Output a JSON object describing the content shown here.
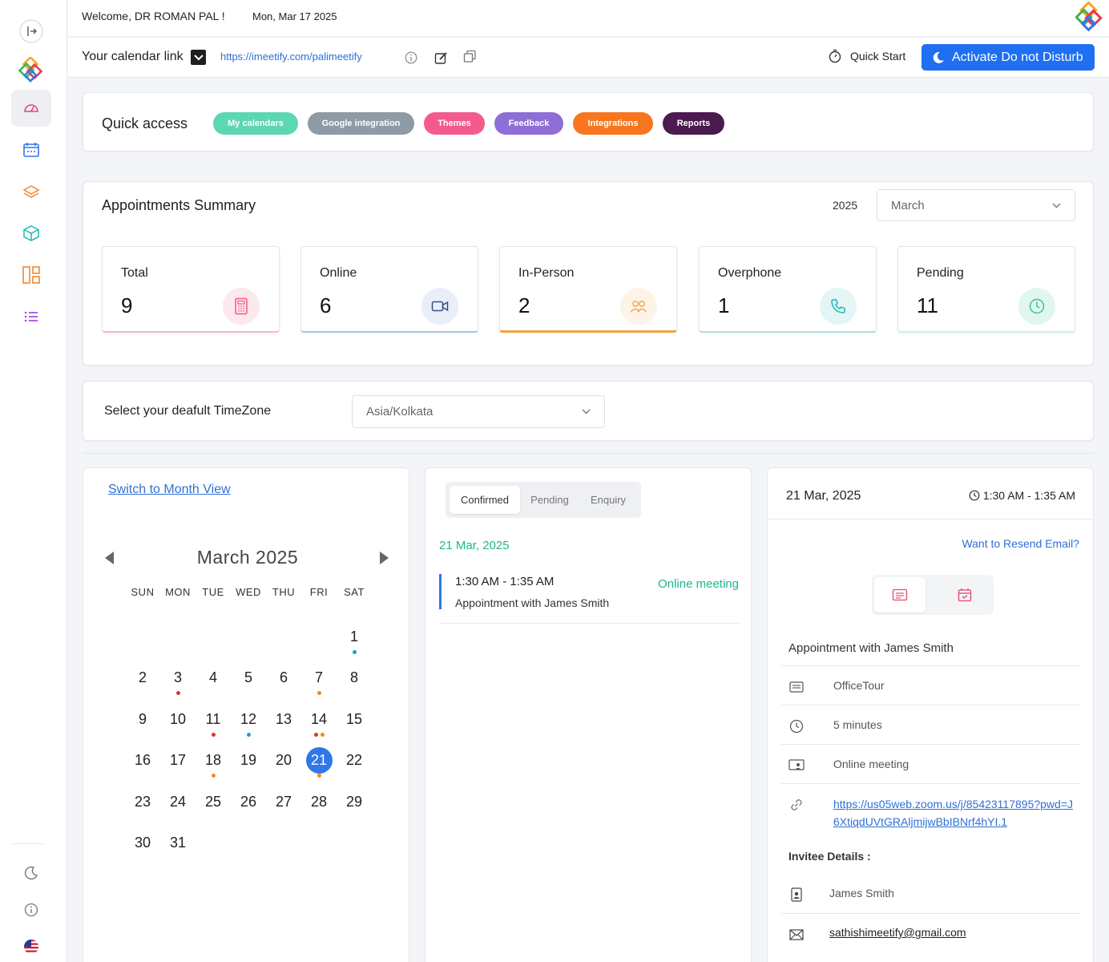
{
  "header": {
    "welcome": "Welcome, DR ROMAN PAL !",
    "date": "Mon, Mar 17 2025",
    "calendar_link_label": "Your calendar link",
    "calendar_url": "https://imeetify.com/palimeetify",
    "quick_start": "Quick Start",
    "dnd_button": "Activate Do not Disturb"
  },
  "quick_access": {
    "title": "Quick access",
    "pills": [
      {
        "label": "My calendars",
        "color": "#5dd6b2"
      },
      {
        "label": "Google integration",
        "color": "#8e9aa6"
      },
      {
        "label": "Themes",
        "color": "#f25b8c"
      },
      {
        "label": "Feedback",
        "color": "#8f6ed5"
      },
      {
        "label": "Integrations",
        "color": "#f7761f"
      },
      {
        "label": "Reports",
        "color": "#4b1a4e"
      }
    ]
  },
  "summary": {
    "title": "Appointments Summary",
    "year": "2025",
    "month": "March",
    "stats": [
      {
        "label": "Total",
        "value": "9",
        "icon": "calculator-icon",
        "color": "#f05a86"
      },
      {
        "label": "Online",
        "value": "6",
        "icon": "video-icon",
        "color": "#5b6fb0"
      },
      {
        "label": "In-Person",
        "value": "2",
        "icon": "people-icon",
        "color": "#f7a34a"
      },
      {
        "label": "Overphone",
        "value": "1",
        "icon": "phone-icon",
        "color": "#20b8b0"
      },
      {
        "label": "Pending",
        "value": "11",
        "icon": "clock-icon",
        "color": "#34c49a"
      }
    ]
  },
  "timezone": {
    "label": "Select your deafult TimeZone",
    "value": "Asia/Kolkata"
  },
  "calendar": {
    "switch_label": "Switch to Month View",
    "title": "March 2025",
    "weekdays": [
      "SUN",
      "MON",
      "TUE",
      "WED",
      "THU",
      "FRI",
      "SAT"
    ],
    "first_weekday_index": 6,
    "days_in_month": 31,
    "selected_day": 21,
    "dots": {
      "1": [
        "#1a9be8"
      ],
      "3": [
        "#e0342b"
      ],
      "7": [
        "#f08a1c"
      ],
      "11": [
        "#e0342b"
      ],
      "12": [
        "#1a9be8"
      ],
      "14": [
        "#e0342b",
        "#f08a1c"
      ],
      "18": [
        "#f08a1c"
      ],
      "21": [
        "#f08a1c"
      ]
    }
  },
  "appointments": {
    "tabs": [
      "Confirmed",
      "Pending",
      "Enquiry"
    ],
    "date": "21 Mar, 2025",
    "items": [
      {
        "time": "1:30 AM - 1:35 AM",
        "title": "Appointment with James Smith",
        "mode": "Online meeting"
      }
    ]
  },
  "detail": {
    "date": "21 Mar, 2025",
    "time": "1:30 AM - 1:35 AM",
    "resend": "Want to Resend Email?",
    "title": "Appointment with James Smith",
    "event_type": "OfficeTour",
    "duration": "5 minutes",
    "mode": "Online meeting",
    "link": "https://us05web.zoom.us/j/85423117895?pwd=J6XtiqdUVtGRAljmijwBbIBNrf4hYI.1",
    "invitee_label": "Invitee Details :",
    "invitee_name": "James Smith",
    "invitee_email": "sathishimeetify@gmail.com"
  }
}
